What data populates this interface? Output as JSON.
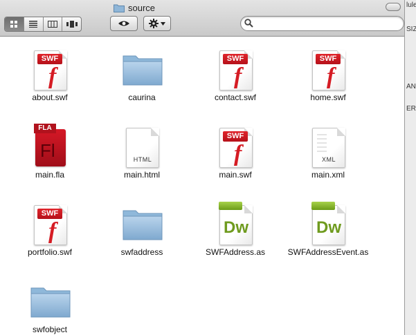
{
  "window": {
    "title": "source"
  },
  "toolbar": {
    "view_buttons": [
      {
        "name": "icon-view",
        "icon": "grid-icon",
        "active": true
      },
      {
        "name": "list-view",
        "icon": "list-icon",
        "active": false
      },
      {
        "name": "column-view",
        "icon": "columns-icon",
        "active": false
      },
      {
        "name": "coverflow-view",
        "icon": "coverflow-icon",
        "active": false
      }
    ],
    "quicklook_icon": "eye-icon",
    "action_icon": "gear-icon",
    "search": {
      "value": "",
      "placeholder": ""
    }
  },
  "background_window": {
    "fragments": [
      "lule",
      "SIZ",
      "AND",
      "ER"
    ]
  },
  "files": [
    {
      "name": "about.swf",
      "type": "swf"
    },
    {
      "name": "caurina",
      "type": "folder"
    },
    {
      "name": "contact.swf",
      "type": "swf"
    },
    {
      "name": "home.swf",
      "type": "swf"
    },
    {
      "name": "main.fla",
      "type": "fla",
      "badge": "FLA",
      "glyph": "Fl"
    },
    {
      "name": "main.html",
      "type": "html",
      "ext": "HTML"
    },
    {
      "name": "main.swf",
      "type": "swf"
    },
    {
      "name": "main.xml",
      "type": "xml",
      "ext": "XML"
    },
    {
      "name": "portfolio.swf",
      "type": "swf"
    },
    {
      "name": "swfaddress",
      "type": "folder"
    },
    {
      "name": "SWFAddress.as",
      "type": "dw",
      "glyph": "Dw"
    },
    {
      "name": "SWFAddressEvent.as",
      "type": "dw",
      "glyph": "Dw"
    },
    {
      "name": "swfobject",
      "type": "folder"
    }
  ],
  "swf_badge": "SWF",
  "colors": {
    "swf_red": "#d51c24",
    "folder_blue": "#8fb8da",
    "dreamweaver_green": "#6f9b1f"
  }
}
